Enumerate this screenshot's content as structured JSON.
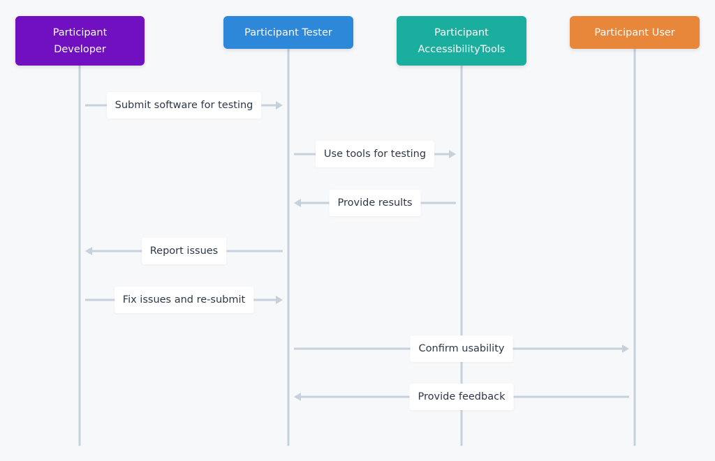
{
  "diagram": {
    "type": "sequence",
    "colors": {
      "background": "#f7f8fa",
      "lifeline": "#c6d1dc",
      "label_text": "#2d3748"
    },
    "participants": [
      {
        "id": "developer",
        "label": "Participant\nDeveloper",
        "color": "#7010c0"
      },
      {
        "id": "tester",
        "label": "Participant Tester",
        "color": "#2d88d9"
      },
      {
        "id": "accessibilitytools",
        "label": "Participant\nAccessibilityTools",
        "color": "#1aae9f"
      },
      {
        "id": "user",
        "label": "Participant User",
        "color": "#e8863a"
      }
    ],
    "messages": [
      {
        "from": "developer",
        "to": "tester",
        "label": "Submit software for testing"
      },
      {
        "from": "tester",
        "to": "accessibilitytools",
        "label": "Use tools for testing"
      },
      {
        "from": "accessibilitytools",
        "to": "tester",
        "label": "Provide results"
      },
      {
        "from": "tester",
        "to": "developer",
        "label": "Report issues"
      },
      {
        "from": "developer",
        "to": "tester",
        "label": "Fix issues and re-submit"
      },
      {
        "from": "tester",
        "to": "user",
        "label": "Confirm usability"
      },
      {
        "from": "user",
        "to": "tester",
        "label": "Provide feedback"
      }
    ]
  }
}
